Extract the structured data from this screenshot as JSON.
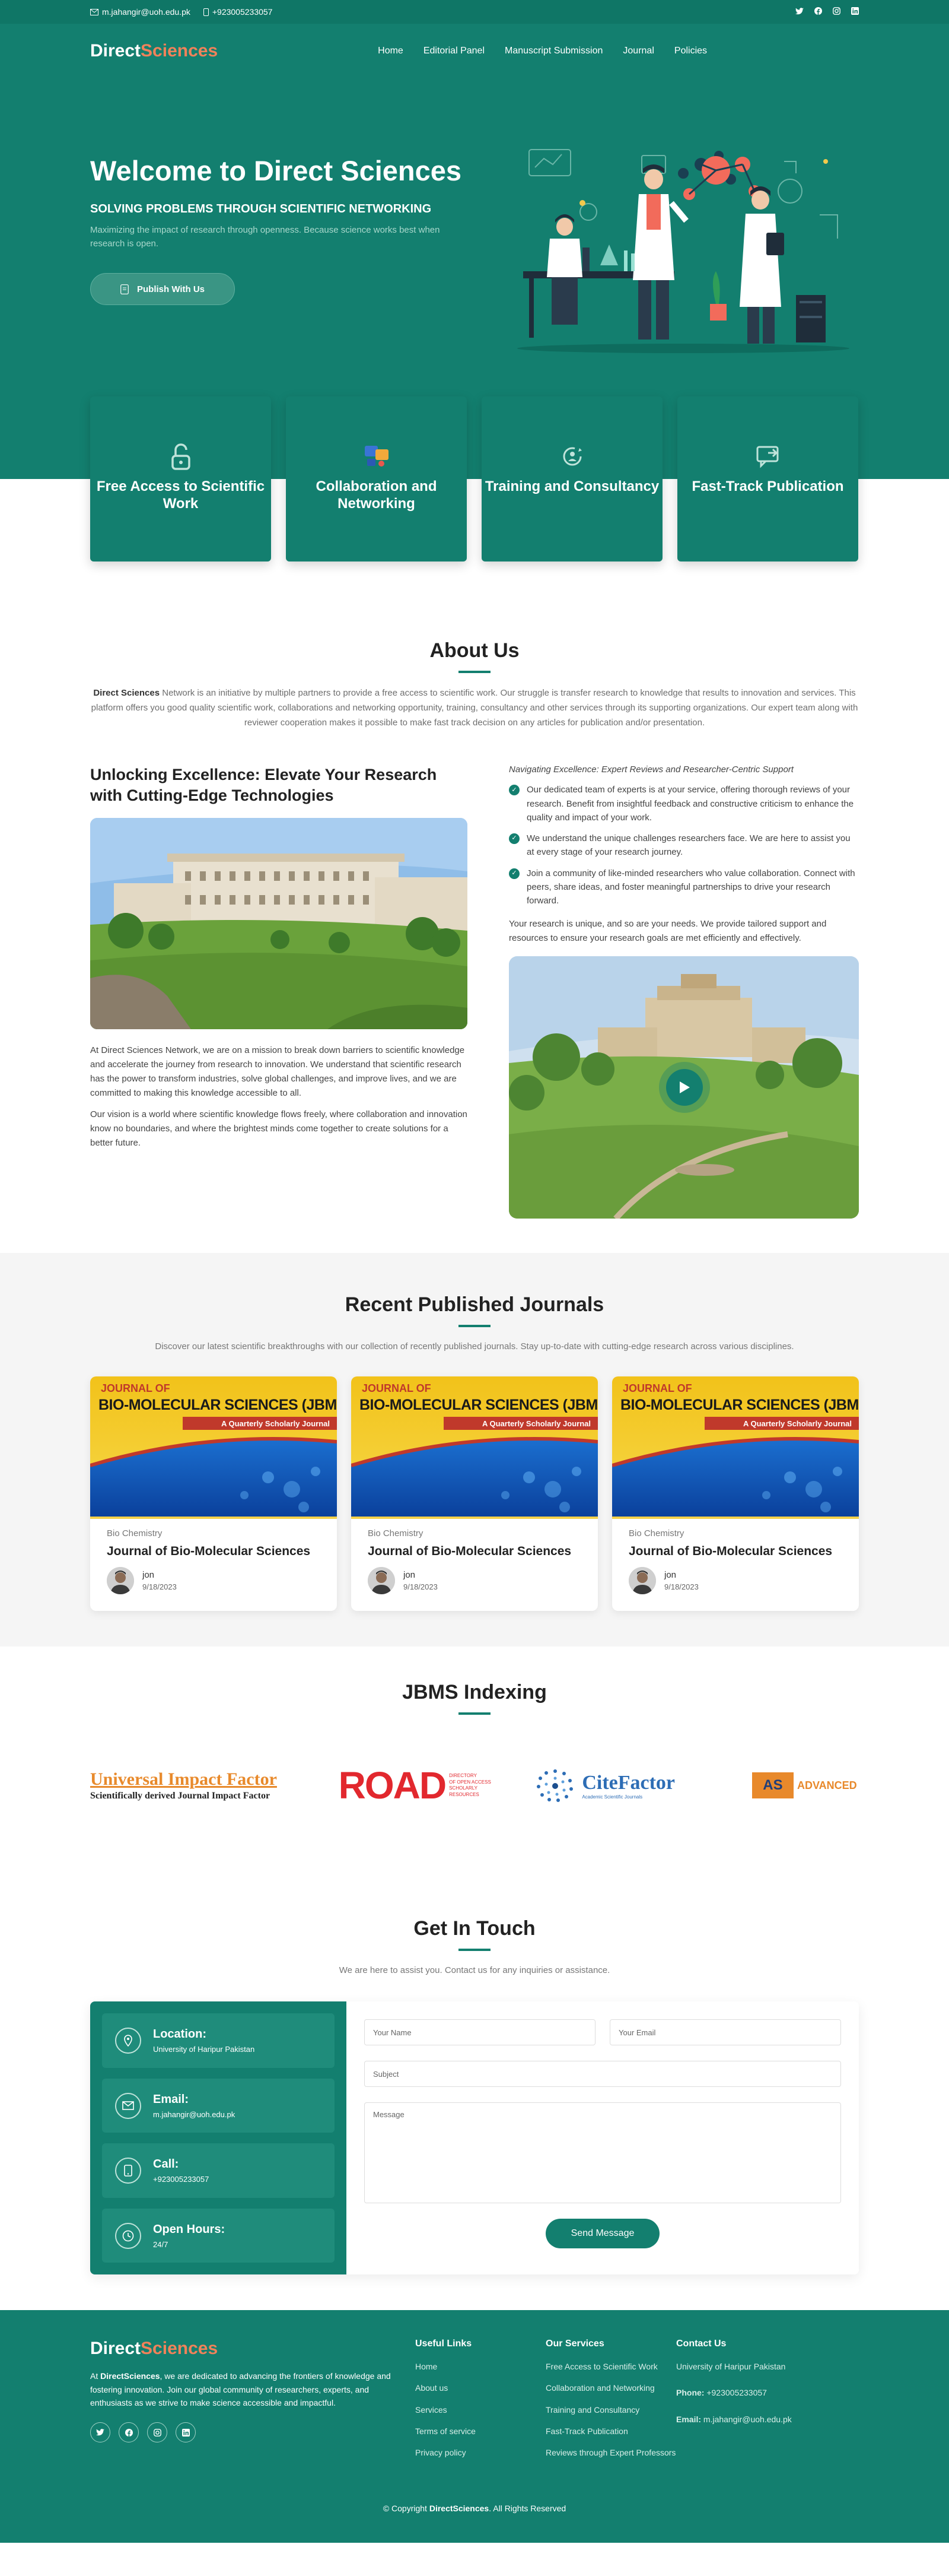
{
  "topbar": {
    "email": "m.jahangir@uoh.edu.pk",
    "phone": "+923005233057"
  },
  "brand": {
    "part1": "Direct",
    "part2": "Sciences"
  },
  "nav": [
    "Home",
    "Editorial Panel",
    "Manuscript Submission",
    "Journal",
    "Policies"
  ],
  "hero": {
    "title": "Welcome to Direct Sciences",
    "subtitle": "SOLVING PROBLEMS THROUGH SCIENTIFIC NETWORKING",
    "description": "Maximizing the impact of research through openness. Because science works best when research is open.",
    "button": "Publish With Us"
  },
  "features": [
    {
      "title": "Free Access to Scientific Work",
      "icon": "lock-open-icon"
    },
    {
      "title": "Collaboration and Networking",
      "icon": "network-icon"
    },
    {
      "title": "Training and Consultancy",
      "icon": "training-icon"
    },
    {
      "title": "Fast-Track Publication",
      "icon": "fast-track-icon"
    }
  ],
  "about": {
    "title": "About Us",
    "intro_bold": "Direct Sciences",
    "intro": " Network is an initiative by multiple partners to provide a free access to scientific work. Our struggle is transfer research to knowledge that results to innovation and services. This platform offers you good quality scientific work, collaborations and networking opportunity, training, consultancy and other services through its supporting organizations. Our expert team along with reviewer cooperation makes it possible to make fast track decision on any articles for publication and/or presentation.",
    "heading": "Unlocking Excellence: Elevate Your Research with Cutting-Edge Technologies",
    "para1": "At Direct Sciences Network, we are on a mission to break down barriers to scientific knowledge and accelerate the journey from research to innovation. We understand that scientific research has the power to transform industries, solve global challenges, and improve lives, and we are committed to making this knowledge accessible to all.",
    "para2": "Our vision is a world where scientific knowledge flows freely, where collaboration and innovation know no boundaries, and where the brightest minds come together to create solutions for a better future.",
    "right_title": "Navigating Excellence: Expert Reviews and Researcher-Centric Support",
    "checks": [
      "Our dedicated team of experts is at your service, offering thorough reviews of your research. Benefit from insightful feedback and constructive criticism to enhance the quality and impact of your work.",
      "We understand the unique challenges researchers face. We are here to assist you at every stage of your research journey.",
      "Join a community of like-minded researchers who value collaboration. Connect with peers, share ideas, and foster meaningful partnerships to drive your research forward."
    ],
    "note": "Your research is unique, and so are your needs. We provide tailored support and resources to ensure your research goals are met efficiently and effectively."
  },
  "journals": {
    "title": "Recent Published Journals",
    "description": "Discover our latest scientific breakthroughs with our collection of recently published journals. Stay up-to-date with cutting-edge research across various disciplines.",
    "cover": {
      "line1": "JOURNAL OF",
      "line2": "BIO-MOLECULAR SCIENCES (JBMS)",
      "tagline": "A Quarterly Scholarly Journal"
    },
    "items": [
      {
        "category": "Bio Chemistry",
        "title": "Journal of Bio-Molecular Sciences",
        "author": "jon",
        "date": "9/18/2023"
      },
      {
        "category": "Bio Chemistry",
        "title": "Journal of Bio-Molecular Sciences",
        "author": "jon",
        "date": "9/18/2023"
      },
      {
        "category": "Bio Chemistry",
        "title": "Journal of Bio-Molecular Sciences",
        "author": "jon",
        "date": "9/18/2023"
      }
    ]
  },
  "indexing": {
    "title": "JBMS Indexing",
    "uif": {
      "name": "Universal Impact Factor",
      "tagline": "Scientifically derived Journal Impact Factor"
    },
    "road": {
      "name": "ROAD",
      "desc1": "DIRECTORY",
      "desc2": "OF OPEN ACCESS",
      "desc3": "SCHOLARLY",
      "desc4": "RESOURCES"
    },
    "citefactor": {
      "name": "CiteFactor",
      "tagline": "Academic Scientific Journals"
    },
    "advanced": {
      "abbr": "AS",
      "name": "ADVANCED"
    }
  },
  "contact": {
    "title": "Get In Touch",
    "description": "We are here to assist you. Contact us for any inquiries or assistance.",
    "info": [
      {
        "label": "Location:",
        "value": "University of Haripur Pakistan",
        "icon": "location-icon"
      },
      {
        "label": "Email:",
        "value": "m.jahangir@uoh.edu.pk",
        "icon": "envelope-icon"
      },
      {
        "label": "Call:",
        "value": "+923005233057",
        "icon": "phone-icon"
      },
      {
        "label": "Open Hours:",
        "value": "24/7",
        "icon": "clock-icon"
      }
    ],
    "form": {
      "name": "Your Name",
      "email": "Your Email",
      "subject": "Subject",
      "message": "Message",
      "button": "Send Message"
    }
  },
  "footer": {
    "about_prefix": "At ",
    "about_bold": "DirectSciences",
    "about": ", we are dedicated to advancing the frontiers of knowledge and fostering innovation. Join our global community of researchers, experts, and enthusiasts as we strive to make science accessible and impactful.",
    "useful_title": "Useful Links",
    "useful": [
      "Home",
      "About us",
      "Services",
      "Terms of service",
      "Privacy policy"
    ],
    "services_title": "Our Services",
    "services": [
      "Free Access to Scientific Work",
      "Collaboration and Networking",
      "Training and Consultancy",
      "Fast-Track Publication",
      "Reviews through Expert Professors"
    ],
    "contact_title": "Contact Us",
    "contact_location": "University of Haripur Pakistan",
    "phone_label": "Phone:",
    "phone": "+923005233057",
    "email_label": "Email:",
    "email": "m.jahangir@uoh.edu.pk",
    "copyright_prefix": "© Copyright ",
    "copyright_brand": "DirectSciences",
    "copyright_suffix": ". All Rights Reserved"
  },
  "colors": {
    "primary": "#137f6f",
    "accent": "#f0825a",
    "topbar": "#0f7666"
  }
}
